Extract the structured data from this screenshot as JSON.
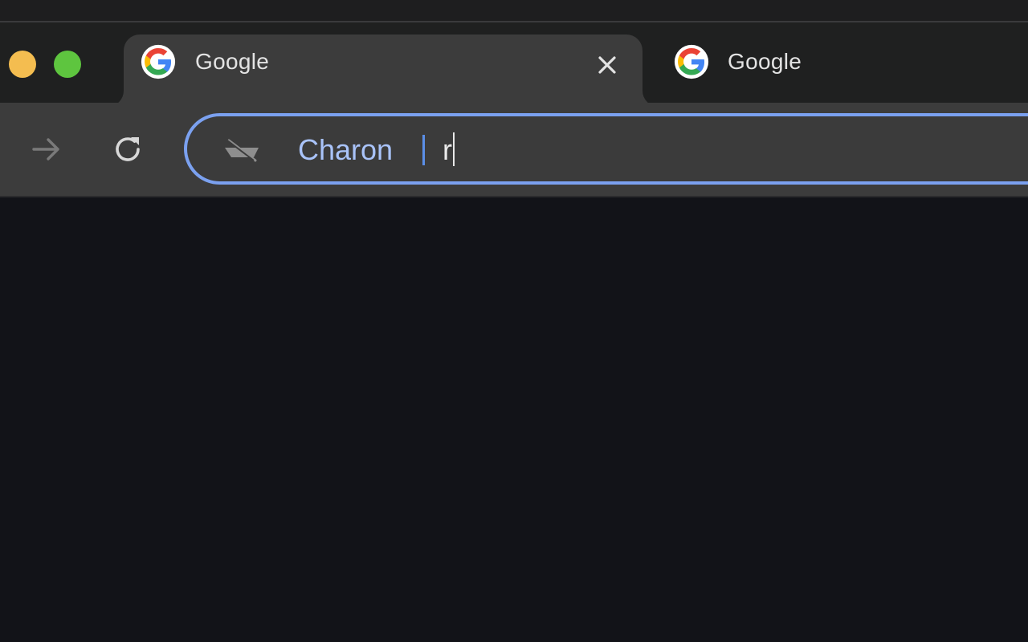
{
  "window": {
    "traffic_lights": [
      {
        "name": "minimize",
        "color": "#f4bd50"
      },
      {
        "name": "zoom",
        "color": "#5ec53f"
      }
    ]
  },
  "tabs": [
    {
      "title": "Google",
      "favicon": "google-g-icon",
      "active": true,
      "close_icon": "close-icon"
    },
    {
      "title": "Google",
      "favicon": "google-g-icon",
      "active": false
    }
  ],
  "toolbar": {
    "forward_icon": "arrow-right-icon",
    "reload_icon": "reload-icon"
  },
  "omnibox": {
    "scope_icon": "boat-icon",
    "scope_chip": "Charon",
    "typed_text": "r",
    "focus_ring_color": "#7ba1f0"
  },
  "colors": {
    "background": "#121318",
    "toolbar": "#3c3c3c",
    "tabstrip": "#1f2020",
    "chip_text": "#a9c3f9"
  }
}
